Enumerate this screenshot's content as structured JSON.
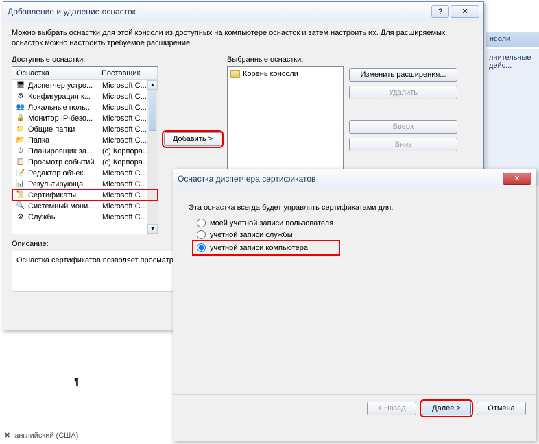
{
  "background": {
    "sidebar_head": "нсоли",
    "sidebar_action": "лнительные дейс...",
    "status_lang": "английский (США)",
    "pilcrow": "¶"
  },
  "dialog1": {
    "title": "Добавление и удаление оснасток",
    "desc": "Можно выбрать оснастки для этой консоли из доступных на компьютере оснасток и затем настроить их. Для расширяемых оснасток можно настроить требуемое расширение.",
    "available_label": "Доступные оснастки:",
    "selected_label": "Выбранные оснастки:",
    "col_snapin": "Оснастка",
    "col_vendor": "Поставщик",
    "snapins": [
      {
        "icon": "🖥",
        "name": "Диспетчер устро...",
        "vendor": "Microsoft C..."
      },
      {
        "icon": "⚙",
        "name": "Конфигурация к...",
        "vendor": "Microsoft C..."
      },
      {
        "icon": "👥",
        "name": "Локальные поль...",
        "vendor": "Microsoft C..."
      },
      {
        "icon": "🔒",
        "name": "Монитор IP-безо...",
        "vendor": "Microsoft C..."
      },
      {
        "icon": "📁",
        "name": "Общие папки",
        "vendor": "Microsoft C..."
      },
      {
        "icon": "📂",
        "name": "Папка",
        "vendor": "Microsoft C..."
      },
      {
        "icon": "⏱",
        "name": "Планировщик за...",
        "vendor": "(с) Корпора..."
      },
      {
        "icon": "📋",
        "name": "Просмотр событий",
        "vendor": "(с) Корпора..."
      },
      {
        "icon": "📝",
        "name": "Редактор объек...",
        "vendor": "Microsoft C..."
      },
      {
        "icon": "📊",
        "name": "Результирующа...",
        "vendor": "Microsoft C..."
      },
      {
        "icon": "📜",
        "name": "Сертификаты",
        "vendor": "Microsoft C..."
      },
      {
        "icon": "🔍",
        "name": "Системный мони...",
        "vendor": "Microsoft C..."
      },
      {
        "icon": "⚙",
        "name": "Службы",
        "vendor": "Microsoft C..."
      }
    ],
    "highlight_index": 10,
    "tree_root": "Корень консоли",
    "btn_add": "Добавить >",
    "btn_edit_ext": "Изменить расширения...",
    "btn_remove": "Удалить",
    "btn_up": "Вверх",
    "btn_down": "Вниз",
    "desc_label": "Описание:",
    "desc_text": "Оснастка сертификатов позволяет просматри\nслужб или компьютеров."
  },
  "dialog2": {
    "title": "Оснастка диспетчера сертификатов",
    "prompt": "Эта оснастка всегда будет управлять сертификатами для:",
    "opt_user": "моей учетной записи пользователя",
    "opt_service": "учетной записи службы",
    "opt_computer": "учетной записи компьютера",
    "btn_back": "< Назад",
    "btn_next": "Далее >",
    "btn_cancel": "Отмена"
  }
}
